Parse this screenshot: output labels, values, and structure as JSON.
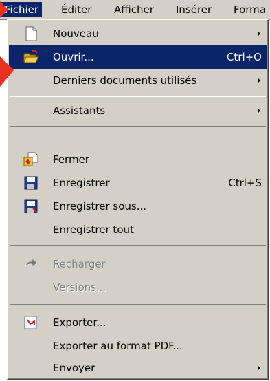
{
  "menubar": {
    "items": [
      {
        "label": "Fichier",
        "state": "open"
      },
      {
        "label": "Éditer"
      },
      {
        "label": "Afficher"
      },
      {
        "label": "Insérer"
      },
      {
        "label": "Forma"
      }
    ]
  },
  "file_menu": {
    "items": [
      {
        "label": "Nouveau",
        "icon": "new-document-icon",
        "has_submenu": true
      },
      {
        "label": "Ouvrir...",
        "icon": "open-folder-icon",
        "shortcut": "Ctrl+O",
        "highlighted": true
      },
      {
        "label": "Derniers documents utilisés",
        "has_submenu": true
      },
      {
        "label": "Assistants",
        "has_submenu": true
      },
      {
        "label": "Fermer",
        "icon": "close-document-icon"
      },
      {
        "label": "Enregistrer",
        "icon": "save-icon",
        "shortcut": "Ctrl+S"
      },
      {
        "label": "Enregistrer sous...",
        "icon": "save-as-icon"
      },
      {
        "label": "Enregistrer tout"
      },
      {
        "label": "Recharger",
        "icon": "reload-icon",
        "disabled": true
      },
      {
        "label": "Versions...",
        "disabled": true
      },
      {
        "label": "Exporter...",
        "icon": "export-icon"
      },
      {
        "label": "Exporter au format PDF..."
      },
      {
        "label": "Envoyer",
        "has_submenu": true
      }
    ]
  },
  "colors": {
    "menu_bg": "#d4d0c8",
    "highlight": "#0a246a",
    "pointer_arrow": "#e8311f"
  }
}
